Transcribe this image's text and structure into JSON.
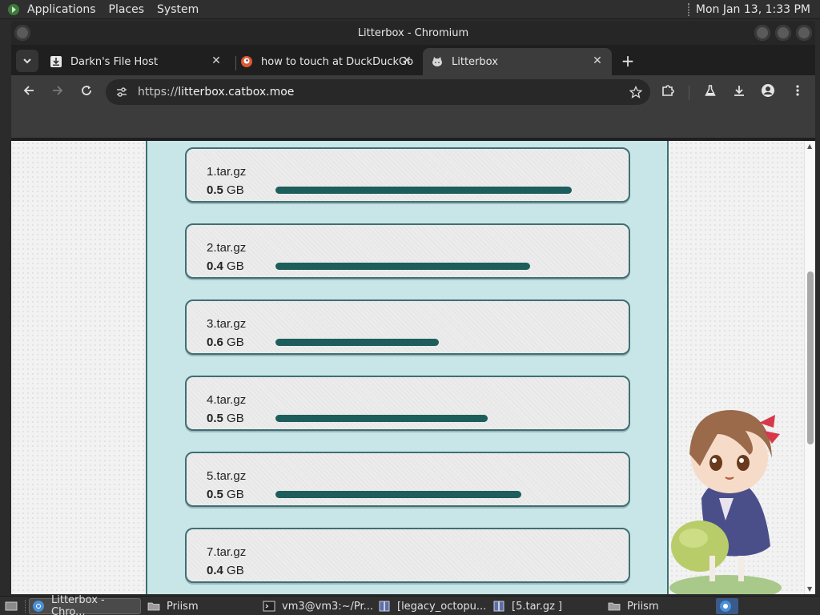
{
  "panel": {
    "menus": [
      "Applications",
      "Places",
      "System"
    ],
    "clock": "Mon Jan 13,  1:33 PM"
  },
  "window": {
    "title": "Litterbox - Chromium"
  },
  "tabs": [
    {
      "label": "Darkn's File Host",
      "icon": "download-icon"
    },
    {
      "label": "how to touch at DuckDuckGo",
      "icon": "duckduckgo-icon"
    },
    {
      "label": "Litterbox",
      "icon": "catbox-icon"
    }
  ],
  "omnibox": {
    "scheme": "https://",
    "host": "litterbox.catbox.moe"
  },
  "files": [
    {
      "name": "1.tar.gz",
      "size_num": "0.5",
      "size_unit": " GB",
      "progress": 1.0
    },
    {
      "name": "2.tar.gz",
      "size_num": "0.4",
      "size_unit": " GB",
      "progress": 0.86
    },
    {
      "name": "3.tar.gz",
      "size_num": "0.6",
      "size_unit": " GB",
      "progress": 0.55
    },
    {
      "name": "4.tar.gz",
      "size_num": "0.5",
      "size_unit": " GB",
      "progress": 0.715
    },
    {
      "name": "5.tar.gz",
      "size_num": "0.5",
      "size_unit": " GB",
      "progress": 0.83
    },
    {
      "name": "7.tar.gz",
      "size_num": "0.4",
      "size_unit": " GB",
      "progress": 0
    }
  ],
  "taskbar": {
    "items": [
      {
        "label": "Litterbox - Chro...",
        "icon": "chromium-icon"
      },
      {
        "label": "Priism",
        "icon": "folder-icon"
      },
      {
        "label": "vm3@vm3:~/Pr...",
        "icon": "terminal-icon"
      },
      {
        "label": "[legacy_octopu...",
        "icon": "archive-icon"
      },
      {
        "label": "[5.tar.gz ]",
        "icon": "archive-icon"
      },
      {
        "label": "Priism",
        "icon": "folder-icon"
      }
    ]
  },
  "colors": {
    "accent": "#1d5e5c",
    "column_bg": "#c8e6e8",
    "card_border": "#3f6f74"
  }
}
